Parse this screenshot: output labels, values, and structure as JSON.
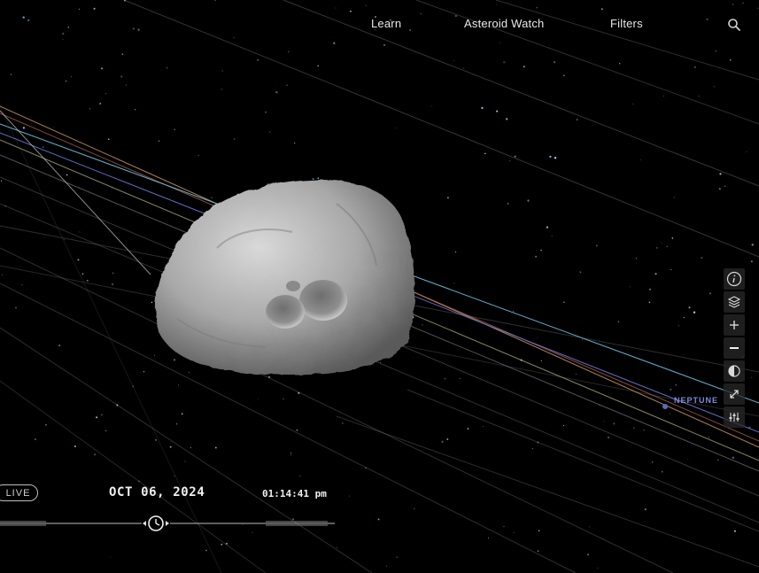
{
  "nav": {
    "items": [
      {
        "label": "Learn",
        "icon": ""
      },
      {
        "label": "Asteroid Watch",
        "icon": ""
      },
      {
        "label": "Filters",
        "icon": ""
      }
    ],
    "search_icon": "search-icon"
  },
  "scene": {
    "object_icon": "asteroid-3d-model",
    "planet_label": "NEPTUNE"
  },
  "toolbar": {
    "buttons": [
      "info-icon",
      "layers-icon",
      "zoom-in-icon",
      "zoom-out-icon",
      "contrast-icon",
      "fullscreen-icon",
      "settings-sliders-icon"
    ]
  },
  "timebar": {
    "live_label": "LIVE",
    "date": "OCT 06, 2024",
    "time": "01:14:41 pm",
    "handle_icon": "clock-icon"
  },
  "colors": {
    "background": "#000000",
    "text": "#e8e8e8",
    "neptune": "#7d8bd9"
  }
}
